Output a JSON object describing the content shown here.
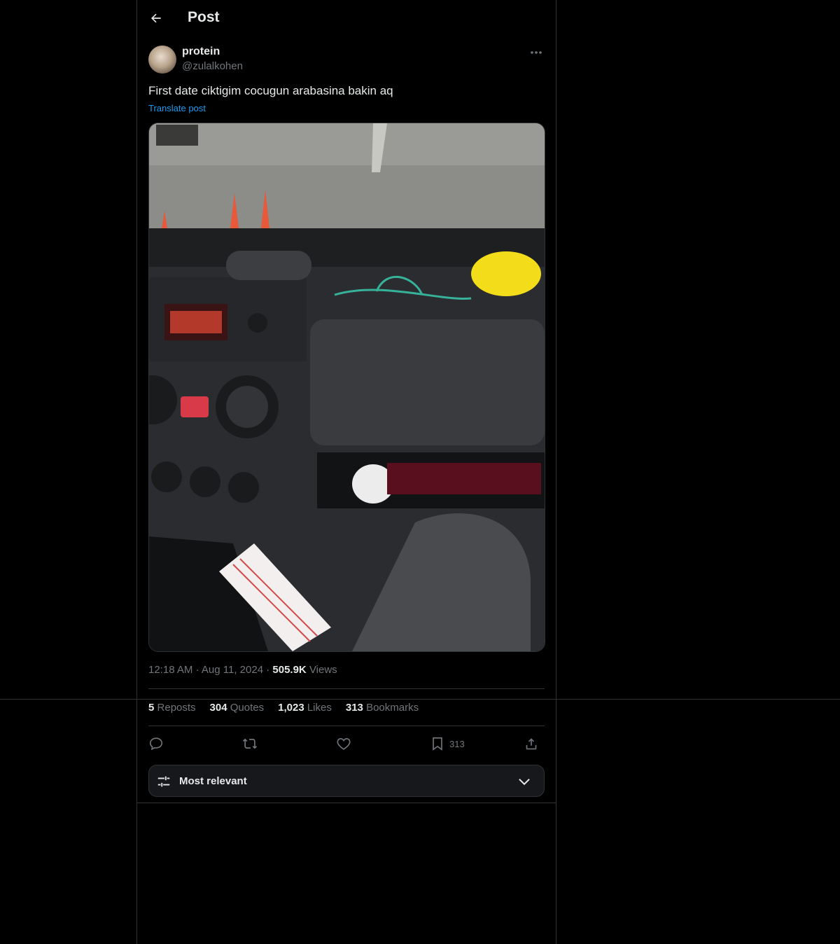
{
  "header": {
    "title": "Post"
  },
  "author": {
    "name": "protein",
    "handle": "@zulalkohen"
  },
  "post": {
    "text": "First date ciktigim cocugun arabasina bakin aq",
    "translate_label": "Translate post"
  },
  "meta": {
    "time": "12:18 AM",
    "date": "Aug 11, 2024",
    "views_count": "505.9K",
    "views_label": "Views",
    "dot": "·"
  },
  "stats": {
    "reposts_count": "5",
    "reposts_label": "Reposts",
    "quotes_count": "304",
    "quotes_label": "Quotes",
    "likes_count": "1,023",
    "likes_label": "Likes",
    "bookmarks_count": "313",
    "bookmarks_label": "Bookmarks"
  },
  "actions": {
    "bookmark_count": "313"
  },
  "sort": {
    "label": "Most relevant"
  },
  "icons": [
    "back-arrow-icon",
    "more-icon",
    "reply-icon",
    "repost-icon",
    "like-icon",
    "bookmark-icon",
    "share-icon",
    "sliders-icon",
    "chevron-down-icon"
  ],
  "colors": {
    "background": "#000000",
    "text": "#e7e9ea",
    "muted": "#71767b",
    "link": "#1d9bf0",
    "border": "#2f3336"
  }
}
